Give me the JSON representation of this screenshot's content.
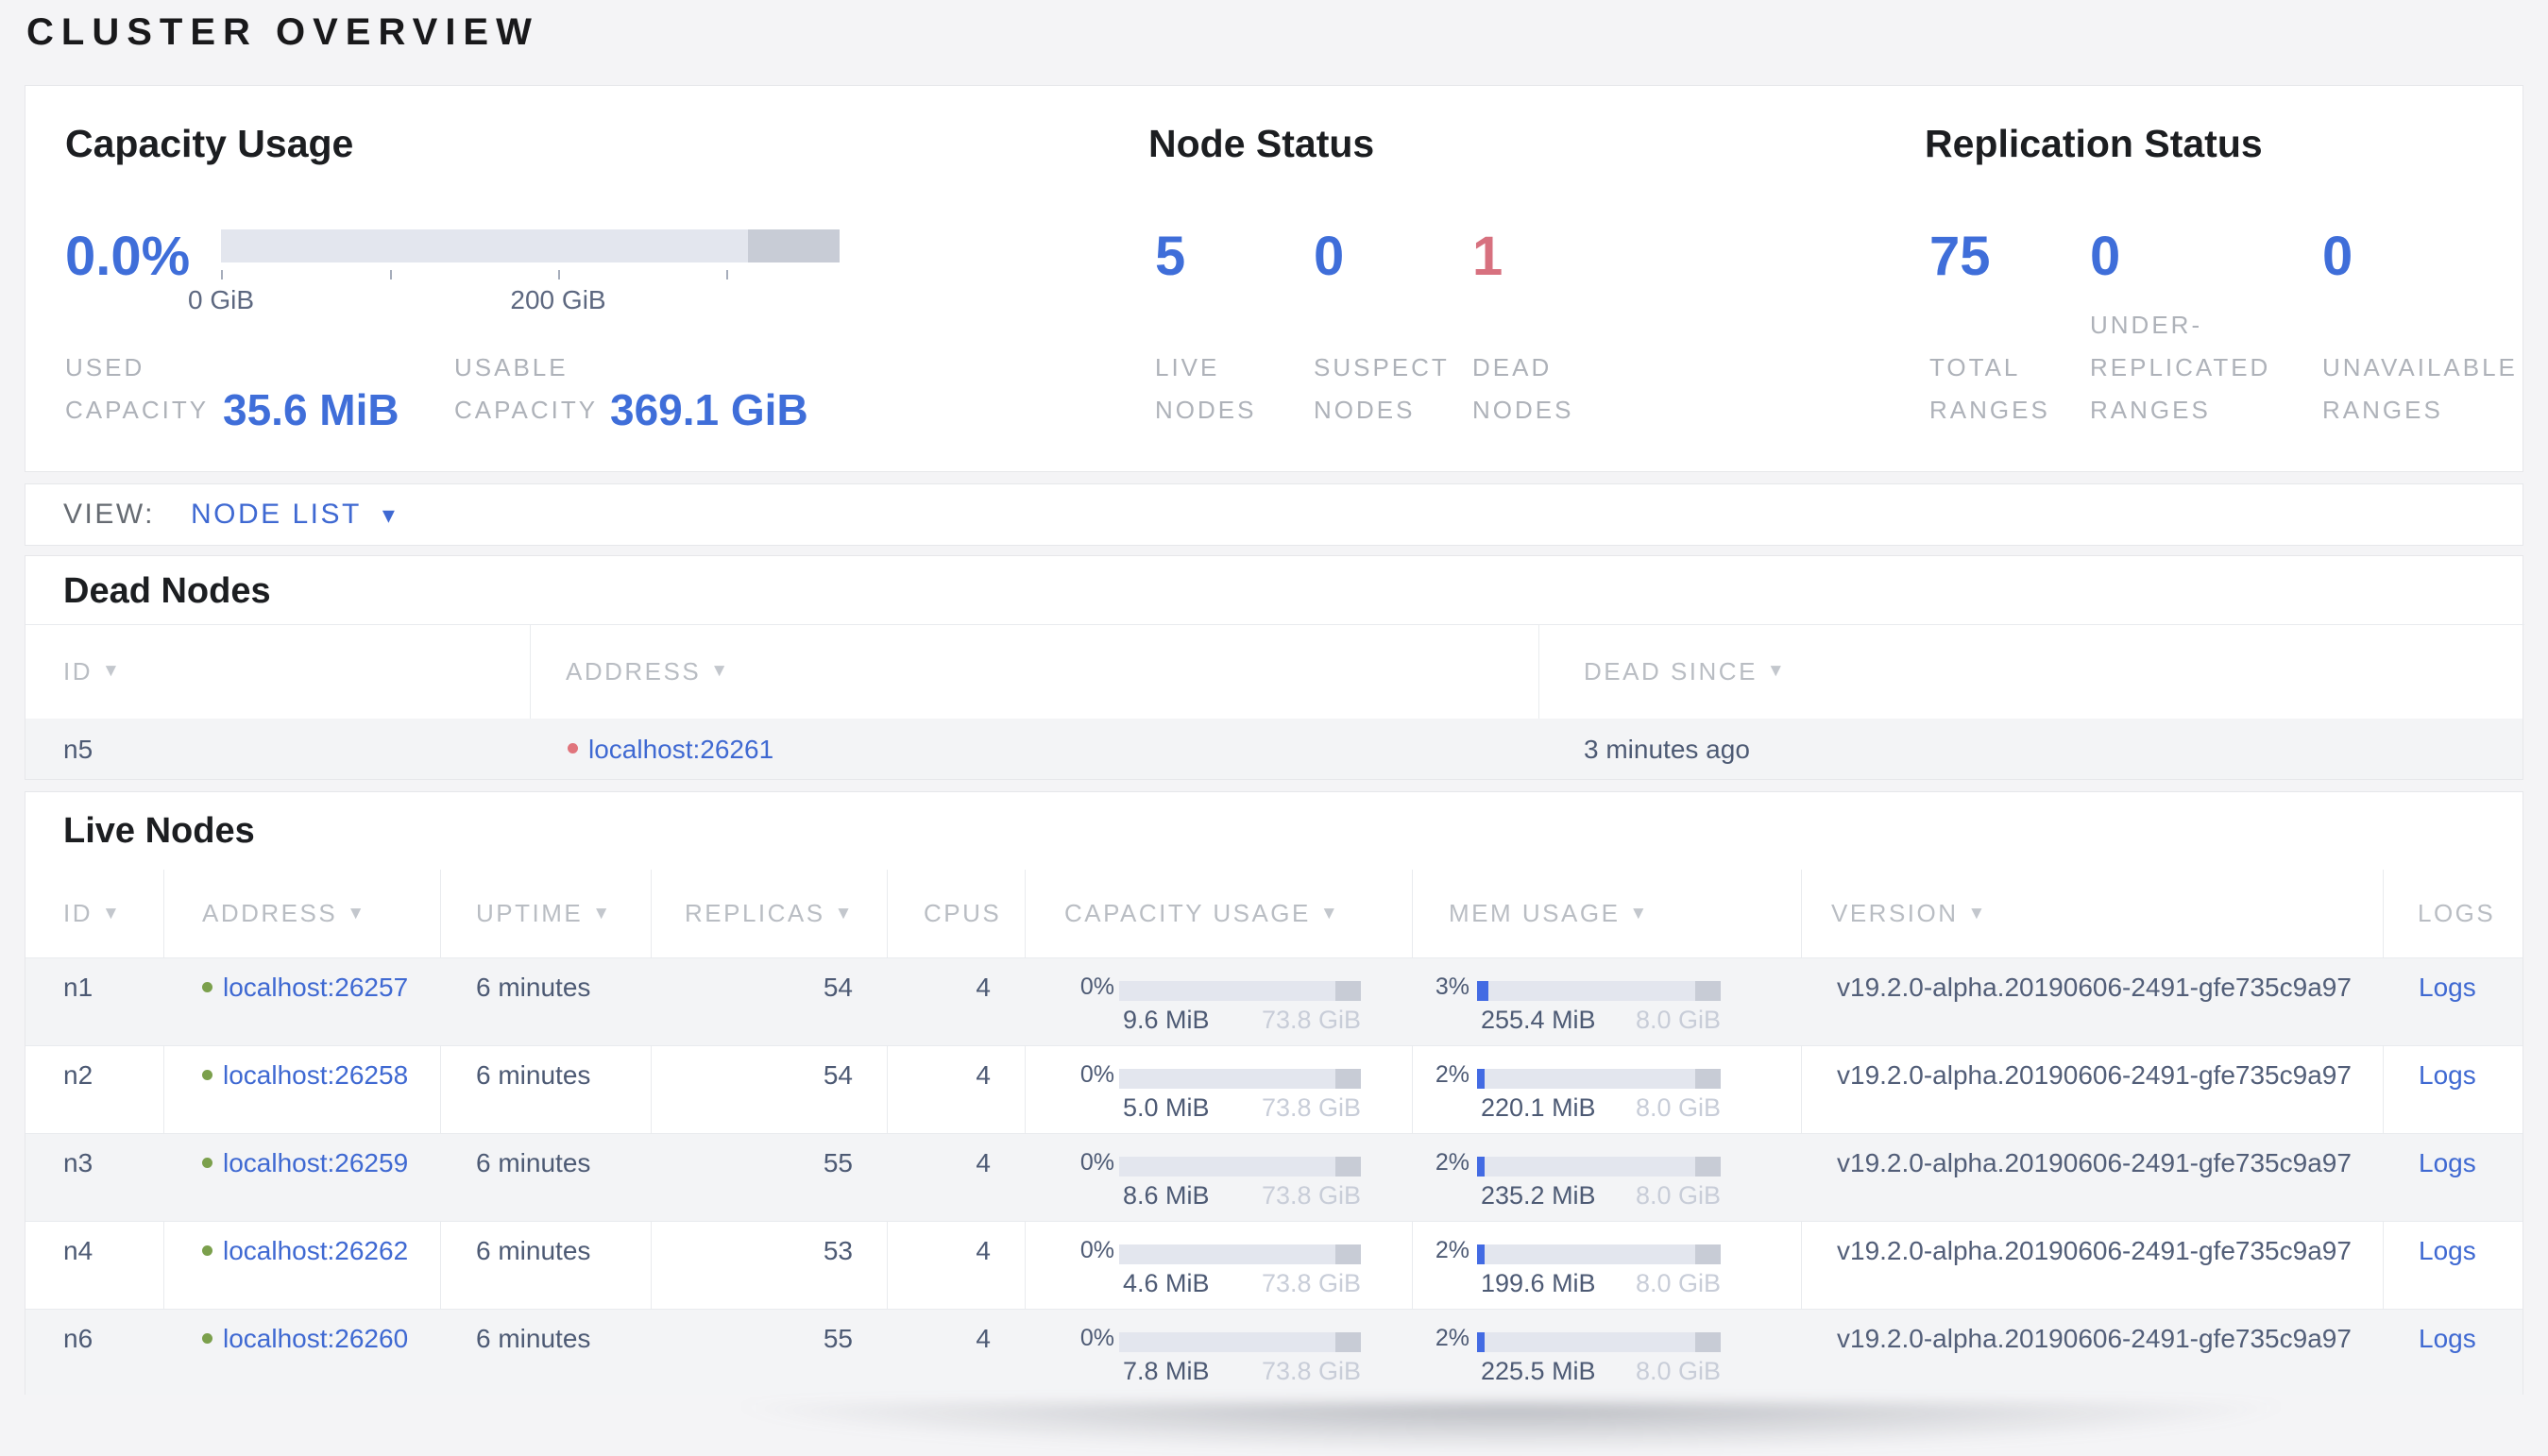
{
  "page": {
    "title": "CLUSTER OVERVIEW"
  },
  "icons": {
    "sort_arrow": "▼",
    "dropdown_caret": "▾",
    "live_dot": "green-circle",
    "dead_dot": "red-circle"
  },
  "colors": {
    "accent_blue": "#3f6ed9",
    "link_blue": "#3f69d2",
    "danger_red": "#d7717f",
    "live_green": "#7ba04c",
    "dead_dot_red": "#e0747c",
    "bar_track": "#e3e6ee",
    "bar_reserved": "#c8ccd6",
    "bar_mem_blue": "#436be3"
  },
  "summary": {
    "capacity": {
      "title": "Capacity Usage",
      "percent": "0.0%",
      "axis": {
        "tick0_label": "0 GiB",
        "tick2_label": "200 GiB"
      },
      "bar": {
        "other_width_pct": 14.8
      },
      "stats": [
        {
          "label": "USED\nCAPACITY",
          "value": "35.6 MiB"
        },
        {
          "label": "USABLE\nCAPACITY",
          "value": "369.1 GiB"
        }
      ]
    },
    "node_status": {
      "title": "Node Status",
      "stats": [
        {
          "value": "5",
          "label": "LIVE\nNODES",
          "tone": "blue"
        },
        {
          "value": "0",
          "label": "SUSPECT\nNODES",
          "tone": "blue"
        },
        {
          "value": "1",
          "label": "DEAD\nNODES",
          "tone": "red"
        }
      ]
    },
    "replication": {
      "title": "Replication Status",
      "stats": [
        {
          "value": "75",
          "label": "TOTAL\nRANGES"
        },
        {
          "value": "0",
          "label": "UNDER-\nREPLICATED\nRANGES"
        },
        {
          "value": "0",
          "label": "UNAVAILABLE\nRANGES"
        }
      ]
    }
  },
  "view_bar": {
    "label": "VIEW:",
    "selected": "NODE LIST"
  },
  "dead_nodes": {
    "title": "Dead Nodes",
    "columns": [
      {
        "label": "ID"
      },
      {
        "label": "ADDRESS"
      },
      {
        "label": "DEAD SINCE"
      }
    ],
    "rows": [
      {
        "id": "n5",
        "address": "localhost:26261",
        "dead_since": "3 minutes ago"
      }
    ]
  },
  "live_nodes": {
    "title": "Live Nodes",
    "columns": [
      {
        "label": "ID"
      },
      {
        "label": "ADDRESS"
      },
      {
        "label": "UPTIME"
      },
      {
        "label": "REPLICAS"
      },
      {
        "label": "CPUS"
      },
      {
        "label": "CAPACITY USAGE"
      },
      {
        "label": "MEM USAGE"
      },
      {
        "label": "VERSION"
      },
      {
        "label": "LOGS"
      }
    ],
    "rows": [
      {
        "id": "n1",
        "address": "localhost:26257",
        "uptime": "6 minutes",
        "replicas": "54",
        "cpus": "4",
        "cap_pct": "0%",
        "cap_used": "9.6 MiB",
        "cap_total": "73.8 GiB",
        "mem_pct": "3%",
        "mem_bar_pct": 4.6,
        "mem_used": "255.4 MiB",
        "mem_total": "8.0 GiB",
        "version": "v19.2.0-alpha.20190606-2491-gfe735c9a97",
        "logs": "Logs"
      },
      {
        "id": "n2",
        "address": "localhost:26258",
        "uptime": "6 minutes",
        "replicas": "54",
        "cpus": "4",
        "cap_pct": "0%",
        "cap_used": "5.0 MiB",
        "cap_total": "73.8 GiB",
        "mem_pct": "2%",
        "mem_bar_pct": 3.1,
        "mem_used": "220.1 MiB",
        "mem_total": "8.0 GiB",
        "version": "v19.2.0-alpha.20190606-2491-gfe735c9a97",
        "logs": "Logs"
      },
      {
        "id": "n3",
        "address": "localhost:26259",
        "uptime": "6 minutes",
        "replicas": "55",
        "cpus": "4",
        "cap_pct": "0%",
        "cap_used": "8.6 MiB",
        "cap_total": "73.8 GiB",
        "mem_pct": "2%",
        "mem_bar_pct": 3.1,
        "mem_used": "235.2 MiB",
        "mem_total": "8.0 GiB",
        "version": "v19.2.0-alpha.20190606-2491-gfe735c9a97",
        "logs": "Logs"
      },
      {
        "id": "n4",
        "address": "localhost:26262",
        "uptime": "6 minutes",
        "replicas": "53",
        "cpus": "4",
        "cap_pct": "0%",
        "cap_used": "4.6 MiB",
        "cap_total": "73.8 GiB",
        "mem_pct": "2%",
        "mem_bar_pct": 3.1,
        "mem_used": "199.6 MiB",
        "mem_total": "8.0 GiB",
        "version": "v19.2.0-alpha.20190606-2491-gfe735c9a97",
        "logs": "Logs"
      },
      {
        "id": "n6",
        "address": "localhost:26260",
        "uptime": "6 minutes",
        "replicas": "55",
        "cpus": "4",
        "cap_pct": "0%",
        "cap_used": "7.8 MiB",
        "cap_total": "73.8 GiB",
        "mem_pct": "2%",
        "mem_bar_pct": 3.1,
        "mem_used": "225.5 MiB",
        "mem_total": "8.0 GiB",
        "version": "v19.2.0-alpha.20190606-2491-gfe735c9a97",
        "logs": "Logs"
      }
    ]
  },
  "bars": {
    "row_reserved_pct": 10.5
  }
}
